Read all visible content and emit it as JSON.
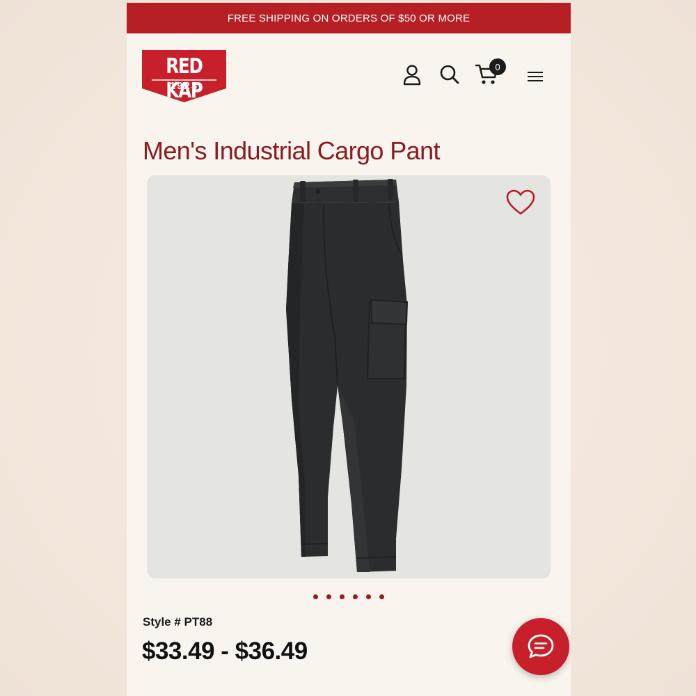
{
  "promo": {
    "text": "FREE SHIPPING ON ORDERS OF $50 OR MORE"
  },
  "brand": {
    "name": "RED KAP",
    "year": "1923",
    "color": "#c8202a"
  },
  "header": {
    "icons": [
      "account-icon",
      "search-icon",
      "cart-icon",
      "hamburger-menu-icon"
    ],
    "cart_count": "0"
  },
  "product": {
    "title": "Men's Industrial Cargo Pant",
    "style_label": "Style # PT88",
    "price_range": "$33.49 - $36.49",
    "image_count": 6,
    "title_color": "#8a1b21"
  },
  "chat": {
    "icon": "chat-bubble-icon"
  }
}
